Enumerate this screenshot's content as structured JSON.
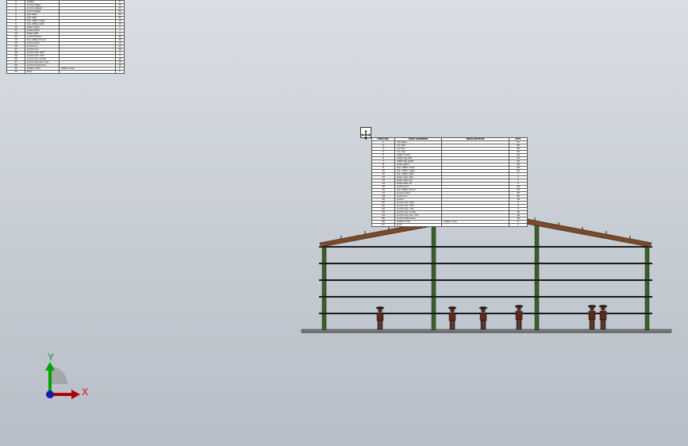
{
  "bom_left": {
    "rows": [
      {
        "no": "1",
        "part": "gutter",
        "desc": "",
        "qty": "12"
      },
      {
        "no": "2",
        "part": "gutter",
        "desc": "",
        "qty": "8"
      },
      {
        "no": "3",
        "part": "purlin edge",
        "desc": "",
        "qty": "24"
      },
      {
        "no": "4",
        "part": "purlin edge2",
        "desc": "",
        "qty": "24"
      },
      {
        "no": "5",
        "part": "purlin edge",
        "desc": "",
        "qty": "24"
      },
      {
        "no": "6",
        "part": "girt side",
        "desc": "",
        "qty": "32"
      },
      {
        "no": "7",
        "part": "girt wall",
        "desc": "",
        "qty": "32"
      },
      {
        "no": "8",
        "part": "top rafter edge",
        "desc": "",
        "qty": "24"
      },
      {
        "no": "9",
        "part": "top rafter wall",
        "desc": "",
        "qty": "24"
      },
      {
        "no": "10",
        "part": "base plate",
        "desc": "",
        "qty": "4"
      },
      {
        "no": "11",
        "part": "base plate",
        "desc": "",
        "qty": "4"
      },
      {
        "no": "12",
        "part": "base wall",
        "desc": "",
        "qty": "4"
      },
      {
        "no": "13",
        "part": "purlin brace",
        "desc": "",
        "qty": "24"
      },
      {
        "no": "14",
        "part": "top rafter brace",
        "desc": "",
        "qty": "24"
      },
      {
        "no": "15",
        "part": "purlin wall",
        "desc": "",
        "qty": "24"
      },
      {
        "no": "16",
        "part": "purlin ns",
        "desc": "",
        "qty": "16"
      },
      {
        "no": "17",
        "part": "purlin nsc",
        "desc": "",
        "qty": "16"
      },
      {
        "no": "18",
        "part": "purlin sec wall",
        "desc": "",
        "qty": "4"
      },
      {
        "no": "19",
        "part": "purlin sec roof",
        "desc": "",
        "qty": "4"
      },
      {
        "no": "20",
        "part": "purlin sec south",
        "desc": "",
        "qty": "16"
      },
      {
        "no": "21",
        "part": "purlin top sec rms",
        "desc": "",
        "qty": "16"
      },
      {
        "no": "22",
        "part": "purlin top brace",
        "desc": "",
        "qty": "16"
      },
      {
        "no": "23",
        "part": "Visitor man",
        "desc": "Visitor man",
        "qty": "6"
      },
      {
        "no": "24",
        "part": "floor",
        "desc": "",
        "qty": "1"
      }
    ]
  },
  "bom_center": {
    "headers": {
      "no": "ITEM NO.",
      "part": "PART NUMBER",
      "desc": "DESCRIPTION",
      "qty": "QTY."
    },
    "rows": [
      {
        "no": "1",
        "part": "col base",
        "desc": "",
        "qty": "11"
      },
      {
        "no": "2",
        "part": "col mid",
        "desc": "",
        "qty": "20"
      },
      {
        "no": "3",
        "part": "col top",
        "desc": "",
        "qty": "20"
      },
      {
        "no": "4",
        "part": "col cap",
        "desc": "",
        "qty": "20"
      },
      {
        "no": "5",
        "part": "rafter main",
        "desc": "",
        "qty": "20"
      },
      {
        "no": "6",
        "part": "rafter flg left",
        "desc": "",
        "qty": "20"
      },
      {
        "no": "7",
        "part": "rafter flg right",
        "desc": "",
        "qty": "20"
      },
      {
        "no": "8",
        "part": "eave strut",
        "desc": "",
        "qty": "20"
      },
      {
        "no": "9",
        "part": "top rafter main",
        "desc": "",
        "qty": "20"
      },
      {
        "no": "10",
        "part": "top rafter edge",
        "desc": "",
        "qty": "20"
      },
      {
        "no": "11",
        "part": "top rafter wall",
        "desc": "",
        "qty": "1"
      },
      {
        "no": "12",
        "part": "base wall side",
        "desc": "",
        "qty": "1"
      },
      {
        "no": "13",
        "part": "base wall top",
        "desc": "",
        "qty": "1"
      },
      {
        "no": "14",
        "part": "base wall rm",
        "desc": "",
        "qty": "1"
      },
      {
        "no": "15",
        "part": "purlin end",
        "desc": "",
        "qty": "20"
      },
      {
        "no": "16",
        "part": "top rafter brace",
        "desc": "",
        "qty": "20"
      },
      {
        "no": "17",
        "part": "purlin main",
        "desc": "",
        "qty": "20"
      },
      {
        "no": "18",
        "part": "purlin ns",
        "desc": "",
        "qty": "20"
      },
      {
        "no": "19",
        "part": "purlin",
        "desc": "",
        "qty": "16"
      },
      {
        "no": "20",
        "part": "purlin sec wall",
        "desc": "",
        "qty": "4"
      },
      {
        "no": "21",
        "part": "purlin sec roof",
        "desc": "",
        "qty": "4"
      },
      {
        "no": "22",
        "part": "purlin sec rms",
        "desc": "",
        "qty": "4"
      },
      {
        "no": "23",
        "part": "purlin sec south",
        "desc": "",
        "qty": "16"
      },
      {
        "no": "24",
        "part": "purlin top sec rms",
        "desc": "",
        "qty": "16"
      },
      {
        "no": "25",
        "part": "purlin top brace",
        "desc": "",
        "qty": "16"
      },
      {
        "no": "26",
        "part": "Visitor man",
        "desc": "Visitor man",
        "qty": "6"
      },
      {
        "no": "27",
        "part": "floor",
        "desc": "",
        "qty": "1"
      }
    ]
  },
  "triad": {
    "x_label": "X",
    "y_label": "Y",
    "x_color": "#d00000",
    "y_color": "#00a000",
    "z_color": "#1a1aaa"
  },
  "colors": {
    "rafter": "#7a4a2a",
    "column": "#3d5e2a",
    "girt": "#202020",
    "floor": "#707070",
    "person": "#5a2b1d"
  },
  "icons": {
    "move": "move-cross-icon"
  }
}
